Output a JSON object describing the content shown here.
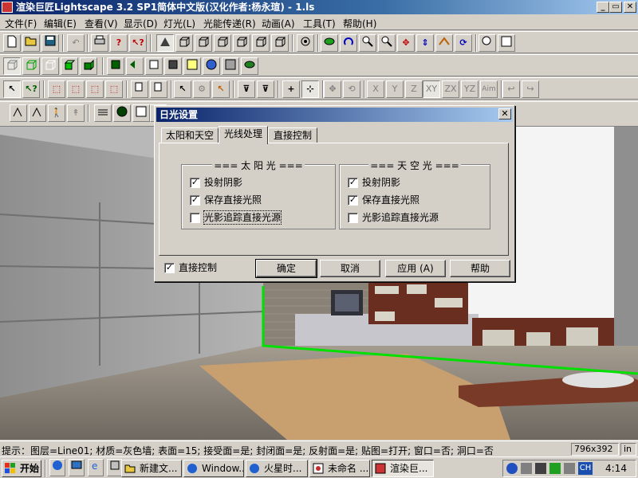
{
  "window": {
    "title": "渲染巨匠Lightscape 3.2 SP1简体中文版(汉化作者:杨永瑄) - 1.ls",
    "controls": [
      "_",
      "▭",
      "✕"
    ]
  },
  "menu": [
    "文件(F)",
    "编辑(E)",
    "查看(V)",
    "显示(D)",
    "灯光(L)",
    "光能传递(R)",
    "动画(A)",
    "工具(T)",
    "帮助(H)"
  ],
  "toolbar_text": {
    "x": "X",
    "y": "Y",
    "z": "Z",
    "xy": "XY",
    "zx": "ZX",
    "yz": "YZ",
    "aim": "Aim"
  },
  "dialog": {
    "title": "日光设置",
    "tabs": [
      "太阳和天空",
      "光线处理",
      "直接控制"
    ],
    "selected_tab": "光线处理",
    "sun_group": {
      "legend": "=== 太 阳 光 ===",
      "options": [
        {
          "label": "投射阴影",
          "checked": true
        },
        {
          "label": "保存直接光照",
          "checked": true
        },
        {
          "label": "光影追踪直接光源",
          "checked": false
        }
      ]
    },
    "sky_group": {
      "legend": "=== 天 空 光 ===",
      "options": [
        {
          "label": "投射阴影",
          "checked": true
        },
        {
          "label": "保存直接光照",
          "checked": true
        },
        {
          "label": "光影追踪直接光源",
          "checked": false
        }
      ]
    },
    "direct_control": {
      "label": "直接控制",
      "checked": true
    },
    "buttons": {
      "ok": "确定",
      "cancel": "取消",
      "apply": "应用 (A)",
      "help": "帮助"
    }
  },
  "status": {
    "text": "提示：图层=Line01; 材质=灰色墙; 表面=15; 接受面=是; 封闭面=是; 反射面=是; 贴图=打开; 窗口=否; 洞口=否",
    "size": "796x392",
    "unit": "in"
  },
  "taskbar": {
    "start": "开始",
    "items": [
      "新建文...",
      "Window...",
      "火星时...",
      "未命名 ...",
      "渲染巨..."
    ],
    "active_index": 4,
    "tray_lang": "CH",
    "clock": "4:14"
  },
  "colors": {
    "title_blue": "#0a246a",
    "selection_green": "#00e000",
    "face": "#d4d0c8"
  }
}
